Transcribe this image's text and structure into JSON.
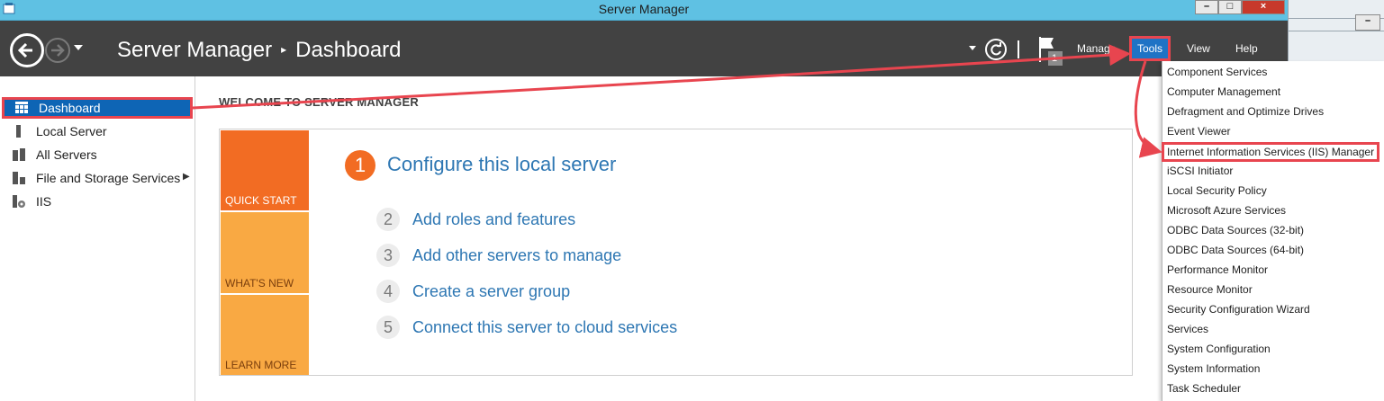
{
  "window": {
    "title": "Server Manager",
    "controls": {
      "minimize": "–",
      "maximize": "□",
      "close": "×"
    }
  },
  "header": {
    "breadcrumb_app": "Server Manager",
    "breadcrumb_separator": "▸",
    "breadcrumb_page": "Dashboard",
    "notification_count": "1",
    "menu": {
      "manage": "Manage",
      "tools": "Tools",
      "view": "View",
      "help": "Help"
    }
  },
  "sidebar": {
    "items": [
      {
        "label": "Dashboard",
        "icon": "dashboard-grid-icon",
        "selected": true
      },
      {
        "label": "Local Server",
        "icon": "server-icon"
      },
      {
        "label": "All Servers",
        "icon": "servers-icon"
      },
      {
        "label": "File and Storage Services",
        "icon": "storage-icon",
        "expand": "▶"
      },
      {
        "label": "IIS",
        "icon": "iis-icon"
      }
    ]
  },
  "main": {
    "welcome": "WELCOME TO SERVER MANAGER",
    "tiles": {
      "quick_start": "QUICK START",
      "whats_new": "WHAT'S NEW",
      "learn_more": "LEARN MORE"
    },
    "steps": [
      {
        "num": "1",
        "label": "Configure this local server"
      },
      {
        "num": "2",
        "label": "Add roles and features"
      },
      {
        "num": "3",
        "label": "Add other servers to manage"
      },
      {
        "num": "4",
        "label": "Create a server group"
      },
      {
        "num": "5",
        "label": "Connect this server to cloud services"
      }
    ]
  },
  "tools_menu": {
    "items": [
      "Component Services",
      "Computer Management",
      "Defragment and Optimize Drives",
      "Event Viewer",
      "Internet Information Services (IIS) Manager",
      "iSCSI Initiator",
      "Local Security Policy",
      "Microsoft Azure Services",
      "ODBC Data Sources (32-bit)",
      "ODBC Data Sources (64-bit)",
      "Performance Monitor",
      "Resource Monitor",
      "Security Configuration Wizard",
      "Services",
      "System Configuration",
      "System Information",
      "Task Scheduler"
    ],
    "highlighted_index": 4
  },
  "colors": {
    "titlebar": "#5fc1e3",
    "header": "#424242",
    "accent_blue": "#0e65b5",
    "annotation_red": "#e8454f",
    "tile_orange": "#f26c23",
    "tile_light_orange": "#f9a943",
    "link_blue": "#2e77b3"
  }
}
